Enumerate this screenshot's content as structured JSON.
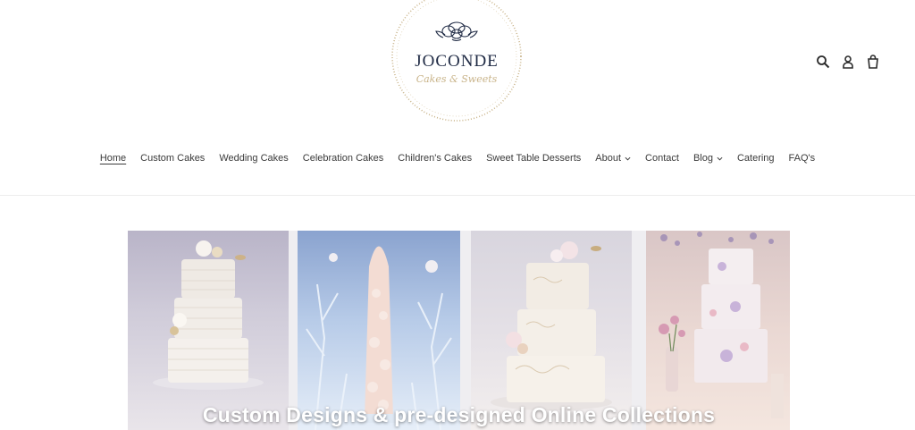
{
  "brand": {
    "name": "JOCONDE",
    "tagline": "Cakes & Sweets"
  },
  "header_icons": [
    "search-icon",
    "account-icon",
    "cart-icon"
  ],
  "nav": {
    "items": [
      {
        "label": "Home",
        "active": true,
        "has_dropdown": false
      },
      {
        "label": "Custom Cakes",
        "active": false,
        "has_dropdown": false
      },
      {
        "label": "Wedding Cakes",
        "active": false,
        "has_dropdown": false
      },
      {
        "label": "Celebration Cakes",
        "active": false,
        "has_dropdown": false
      },
      {
        "label": "Children's Cakes",
        "active": false,
        "has_dropdown": false
      },
      {
        "label": "Sweet Table Desserts",
        "active": false,
        "has_dropdown": false
      },
      {
        "label": "About",
        "active": false,
        "has_dropdown": true
      },
      {
        "label": "Contact",
        "active": false,
        "has_dropdown": false
      },
      {
        "label": "Blog",
        "active": false,
        "has_dropdown": true
      },
      {
        "label": "Catering",
        "active": false,
        "has_dropdown": false
      },
      {
        "label": "FAQ's",
        "active": false,
        "has_dropdown": false
      }
    ]
  },
  "hero": {
    "caption": "Custom Designs & pre-designed Online Collections"
  },
  "colors": {
    "text": "#3a3a3a",
    "logo_ink": "#1f2a44",
    "logo_gold": "#c9b48a",
    "caption": "#ffffff"
  }
}
